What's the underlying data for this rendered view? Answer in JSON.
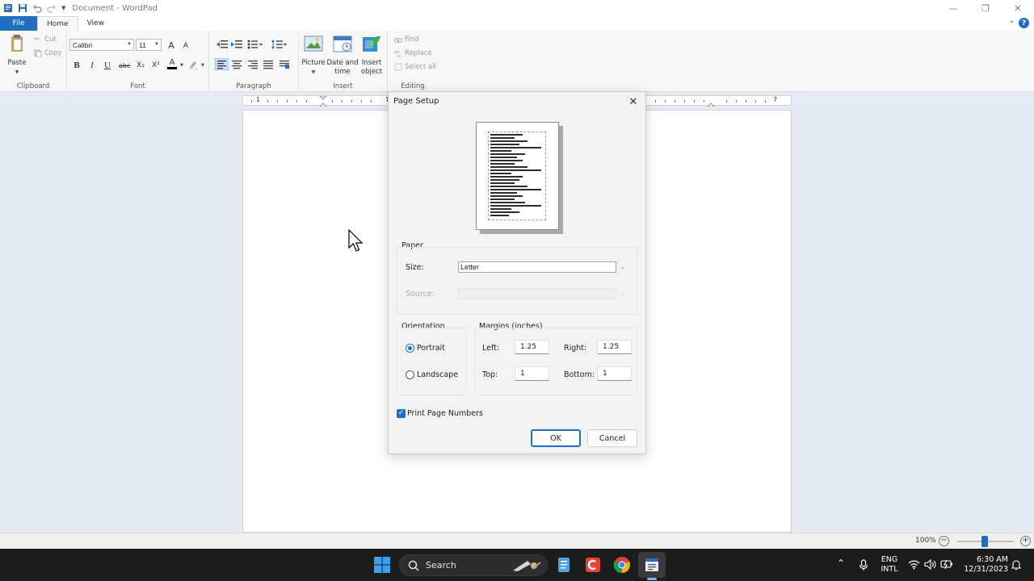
{
  "titlebar": {
    "title": "Document - WordPad",
    "controls": {
      "minimize": "—",
      "maximize": "❐",
      "close": "✕"
    }
  },
  "ribbon": {
    "tabs": [
      {
        "label": "File"
      },
      {
        "label": "Home"
      },
      {
        "label": "View"
      }
    ],
    "minimize_glyph": "⌄",
    "help_glyph": "?",
    "clipboard": {
      "group_label": "Clipboard",
      "paste": "Paste",
      "cut": "Cut",
      "copy": "Copy"
    },
    "font": {
      "group_label": "Font",
      "family": "Calibri",
      "size": "11",
      "grow": "A",
      "shrink": "A",
      "bold": "B",
      "italic": "I",
      "underline": "U",
      "strike": "abc",
      "subscript": "X₂",
      "superscript": "X²",
      "color": "A"
    },
    "paragraph": {
      "group_label": "Paragraph"
    },
    "insert": {
      "group_label": "Insert",
      "picture": "Picture",
      "datetime_1": "Date and",
      "datetime_2": "time",
      "object_1": "Insert",
      "object_2": "object"
    },
    "editing": {
      "group_label": "Editing",
      "find": "Find",
      "replace": "Replace",
      "select_all": "Select all"
    }
  },
  "ruler": {
    "marks": [
      "1",
      "1",
      "7"
    ]
  },
  "dialog": {
    "title": "Page Setup",
    "close": "✕",
    "paper": {
      "label": "Paper",
      "size_label": "Size:",
      "size_value": "Letter",
      "source_label": "Source:",
      "source_value": ""
    },
    "orientation": {
      "label": "Orientation",
      "portrait": "Portrait",
      "landscape": "Landscape",
      "selected": "Portrait"
    },
    "margins": {
      "label": "Margins (inches)",
      "left_label": "Left:",
      "left": "1.25",
      "right_label": "Right:",
      "right": "1.25",
      "top_label": "Top:",
      "top": "1",
      "bottom_label": "Bottom:",
      "bottom": "1"
    },
    "print_page_numbers": {
      "label": "Print Page Numbers",
      "checked": "✓"
    },
    "ok": "OK",
    "cancel": "Cancel"
  },
  "statusbar": {
    "zoom": "100%",
    "zoom_minus": "−",
    "zoom_plus": "+"
  },
  "taskbar": {
    "search_placeholder": "Search",
    "language_1": "ENG",
    "language_2": "INTL",
    "time": "6:30 AM",
    "date": "12/31/2023",
    "tray_chevron": "⌃"
  },
  "colors": {
    "accent": "#1e6fc2",
    "workspace": "#e5ebf5",
    "taskbar": "#1c1c1c"
  }
}
